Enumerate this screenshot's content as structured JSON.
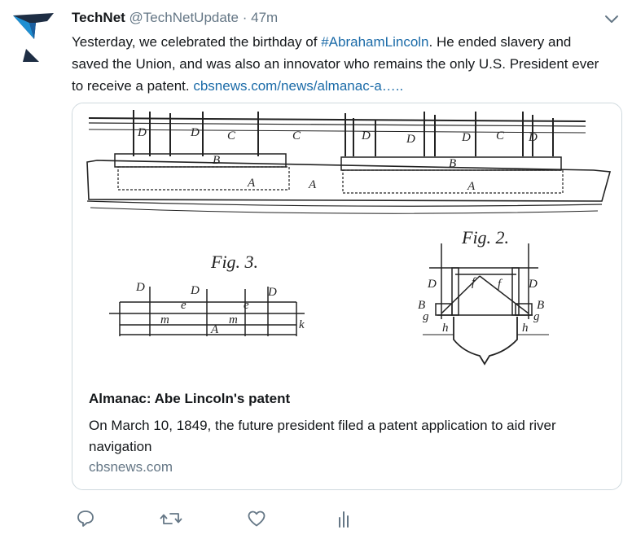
{
  "tweet": {
    "author_name": "TechNet",
    "author_handle": "@TechNetUpdate",
    "separator": "·",
    "timestamp": "47m",
    "text_before": "Yesterday, we celebrated the birthday of ",
    "hashtag": "#AbrahamLincoln",
    "text_after": ". He ended slavery and saved the Union, and was also an innovator who remains the only U.S. President ever to receive a patent. ",
    "link": "cbsnews.com/news/almanac-a…..",
    "colors": {
      "link": "#1b6ba8",
      "secondary": "#657786",
      "avatar_dark": "#1e2e44",
      "avatar_light": "#1e8fd2"
    }
  },
  "card": {
    "title": "Almanac: Abe Lincoln's patent",
    "description": "On March 10, 1849, the future president filed a patent application to aid river navigation",
    "domain": "cbsnews.com",
    "figure_labels": {
      "fig3": "Fig. 3.",
      "fig2": "Fig. 2.",
      "d": "D",
      "f": "f",
      "c": "C",
      "b": "B",
      "a": "A",
      "e": "e",
      "m": "m",
      "k": "k",
      "g": "g",
      "h": "h"
    }
  },
  "actions": [
    {
      "icon": "reply-icon"
    },
    {
      "icon": "retweet-icon"
    },
    {
      "icon": "like-icon"
    },
    {
      "icon": "analytics-icon"
    }
  ]
}
